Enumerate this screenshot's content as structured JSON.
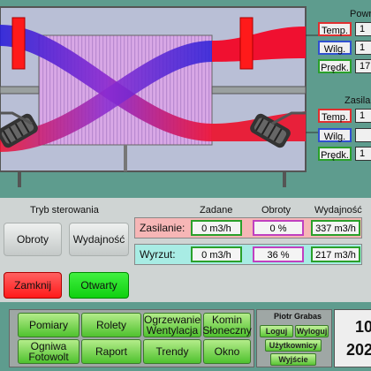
{
  "outdoor": {
    "title": "Powr",
    "labels": {
      "temp": "Temp.",
      "humidity": "Wilg.",
      "speed": "Prędk."
    },
    "values": {
      "temp": "1",
      "humidity": "1",
      "speed": "17"
    }
  },
  "supply": {
    "title": "Zasila",
    "labels": {
      "temp": "Temp.",
      "humidity": "Wilg.",
      "speed": "Prędk."
    },
    "values": {
      "temp": "1",
      "humidity": "",
      "speed": "1"
    }
  },
  "control": {
    "mode_label": "Tryb sterowania",
    "buttons": {
      "speed": "Obroty",
      "output": "Wydajność",
      "close": "Zamknij",
      "open": "Otwarty"
    },
    "headers": {
      "setpoint": "Zadane",
      "speed": "Obroty",
      "output": "Wydajność"
    },
    "rows": [
      {
        "name": "Zasilanie:",
        "setpoint": "0 m3/h",
        "speed": "0 %",
        "output": "337 m3/h"
      },
      {
        "name": "Wyrzut:",
        "setpoint": "0 m3/h",
        "speed": "36 %",
        "output": "217 m3/h"
      }
    ]
  },
  "nav": {
    "items": [
      "Pomiary",
      "Rolety",
      "Ogrzewanie Wentylacja",
      "Komin Słoneczny",
      "Ogniwa Fotowolt",
      "Raport",
      "Trendy",
      "Okno"
    ]
  },
  "user": {
    "name": "Piotr Grabas",
    "login": "Loguj",
    "logout": "Wyloguj",
    "users": "Użytkownicy",
    "exit": "Wyjście"
  },
  "clock": {
    "time": "10",
    "year": "202"
  },
  "colors": {
    "background": "#5e9c8e",
    "nav_green": "#4fc22e",
    "close_red": "#ff3333",
    "open_green": "#22e022"
  }
}
